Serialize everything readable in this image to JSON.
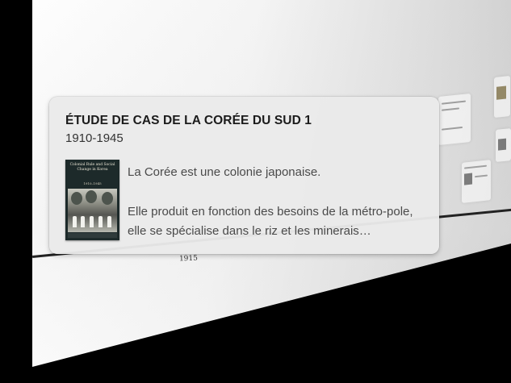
{
  "event": {
    "title": "ÉTUDE DE CAS DE LA CORÉE DU SUD 1",
    "dates": "1910-1945",
    "paragraphs": [
      "La Corée est une colonie japonaise.",
      "Elle produit en fonction des besoins de la métro-pole, elle se spécialise dans le riz et les minerais…"
    ],
    "book_cover": {
      "title": "Colonial Rule and Social Change in Korea",
      "years": "1910–1945"
    }
  },
  "timeline": {
    "axis_label": "1915"
  },
  "colors": {
    "background": "#000000",
    "card": "#eaeaea",
    "title_text": "#1b1b1b",
    "body_text": "#4a4a4a"
  }
}
